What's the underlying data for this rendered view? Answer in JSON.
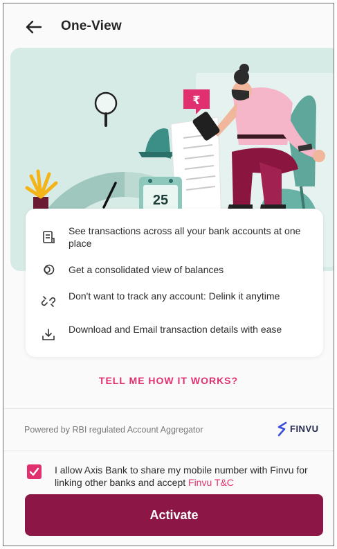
{
  "header": {
    "back_icon": "arrow-left-icon",
    "title": "One-View"
  },
  "hero": {
    "calendar_day": "25",
    "rupee_symbol": "₹"
  },
  "features": [
    {
      "icon": "statement-icon",
      "text": "See transactions across all your bank accounts at one place"
    },
    {
      "icon": "coins-icon",
      "text": "Get a consolidated view of balances"
    },
    {
      "icon": "unlink-icon",
      "text": "Don't want to track any account: Delink it anytime"
    },
    {
      "icon": "download-icon",
      "text": "Download and Email transaction details with ease"
    }
  ],
  "how_it_works_link": "TELL ME HOW IT WORKS?",
  "footer": {
    "powered_by": "Powered by RBI regulated Account Aggregator",
    "brand_name": "FINVU"
  },
  "consent": {
    "checked": true,
    "text": "I allow Axis Bank to share my mobile number with Finvu for linking other banks and accept ",
    "link_text": "Finvu T&C"
  },
  "activate_label": "Activate",
  "colors": {
    "accent": "#e0306f",
    "primary_button": "#8c1747",
    "hero_bg": "#d7ebe6"
  }
}
